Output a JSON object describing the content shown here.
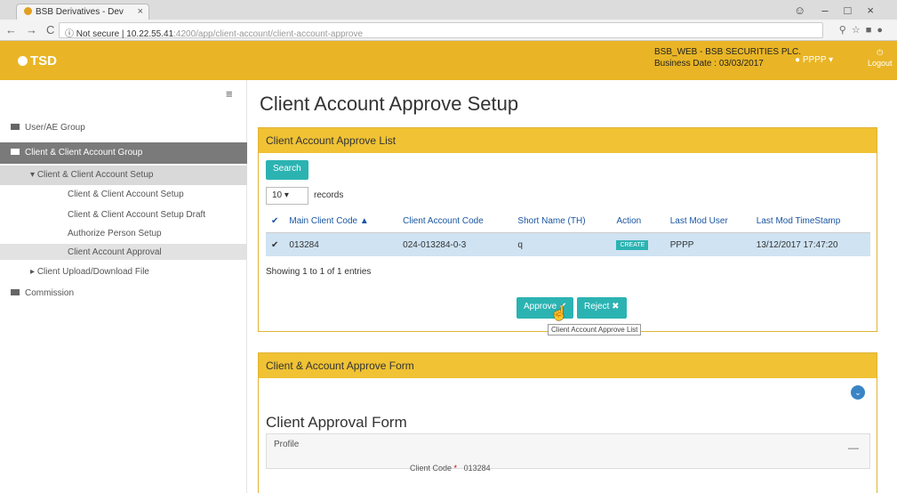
{
  "browser": {
    "tab_title": "BSB Derivatives - Dev",
    "not_secure": "Not secure",
    "url_host": "10.22.55.41",
    "url_rest": ":4200/app/client-account/client-account-approve"
  },
  "header": {
    "logo": "TSD",
    "company": "BSB_WEB - BSB SECURITIES PLC.",
    "business_date": "Business Date : 03/03/2017",
    "user": "PPPP",
    "logout": "Logout"
  },
  "sidebar": {
    "items": [
      {
        "label": "User/AE Group"
      },
      {
        "label": "Client & Client Account Group"
      },
      {
        "label": "Client & Client Account Setup"
      },
      {
        "label": "Client & Client Account Setup"
      },
      {
        "label": "Client & Client Account Setup Draft"
      },
      {
        "label": "Authorize Person Setup"
      },
      {
        "label": "Client Account Approval"
      },
      {
        "label": "Client Upload/Download File"
      },
      {
        "label": "Commission"
      }
    ]
  },
  "main": {
    "title": "Client Account Approve Setup",
    "list_panel": {
      "heading": "Client Account Approve List",
      "search": "Search",
      "page_size": "10",
      "records": "records",
      "columns": [
        "Main Client Code",
        "Client Account Code",
        "Short Name (TH)",
        "Action",
        "Last Mod User",
        "Last Mod TimeStamp"
      ],
      "rows": [
        [
          "013284",
          "024-013284-0-3",
          "q",
          "CREATE",
          "PPPP",
          "13/12/2017 17:47:20"
        ]
      ],
      "showing": "Showing 1 to 1 of 1 entries",
      "approve": "Approve",
      "reject": "Reject",
      "tooltip": "Client Account Approve List"
    },
    "form_panel": {
      "heading": "Client & Account Approve Form",
      "form_title": "Client Approval Form",
      "profile": "Profile",
      "client_code_label": "Client Code",
      "client_code_value": "013284"
    }
  }
}
